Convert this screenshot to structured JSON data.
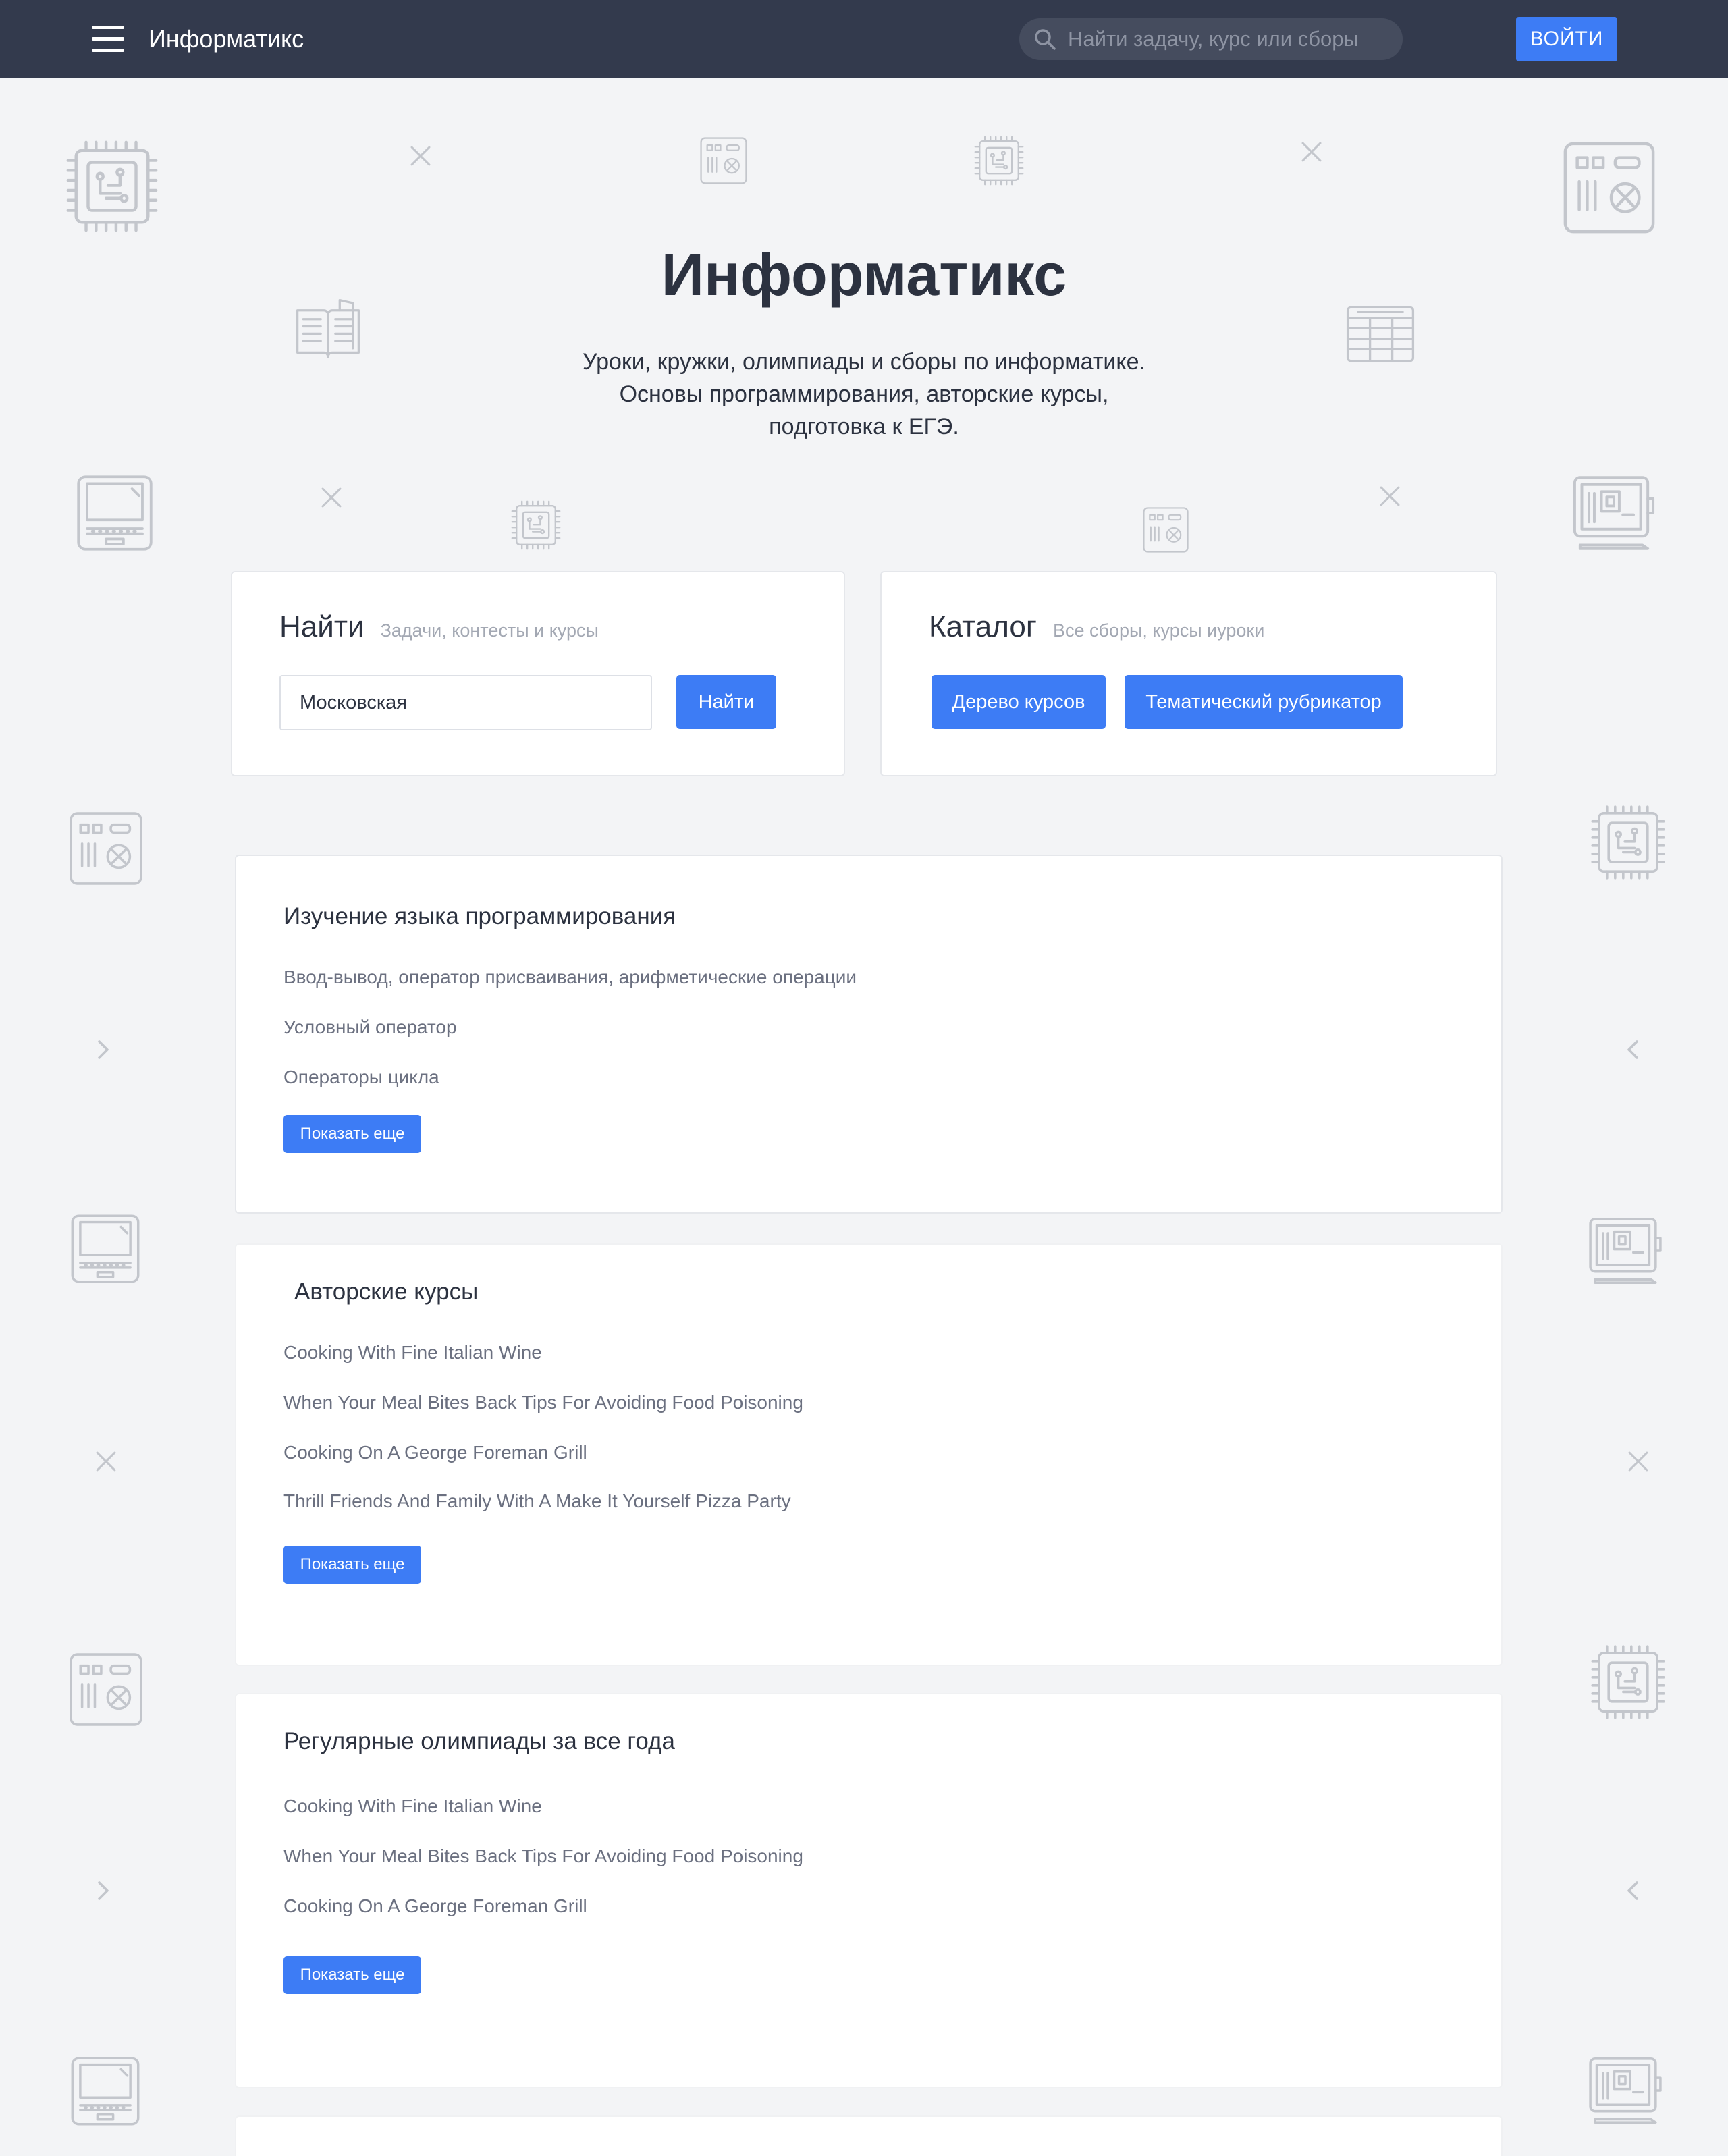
{
  "header": {
    "brand": "Информатикс",
    "search_placeholder": "Найти задачу, курс или сборы",
    "login_label": "ВОЙТИ"
  },
  "hero": {
    "title": "Информатикс",
    "subtitle_lines": [
      "Уроки, кружки, олимпиады и сборы по информатике.",
      "Основы программирования, авторские курсы,",
      "подготовка к ЕГЭ."
    ]
  },
  "find_card": {
    "title": "Найти",
    "hint": "Задачи, контесты и курсы",
    "input_value": "Московская",
    "button_label": "Найти"
  },
  "catalog_card": {
    "title": "Каталог",
    "hint": "Все сборы, курсы иуроки",
    "buttons": [
      "Дерево курсов",
      "Тематический рубрикатор"
    ]
  },
  "sections": [
    {
      "title": "Изучение языка программирования",
      "items": [
        "Ввод-вывод, оператор присваивания, арифметические операции",
        "Условный оператор",
        "Операторы цикла"
      ],
      "more_label": "Показать еще"
    },
    {
      "title": "Авторские курсы",
      "items": [
        "Cooking With Fine Italian Wine",
        "When Your Meal Bites Back Tips For Avoiding Food Poisoning",
        "Cooking On A George Foreman Grill",
        "Thrill Friends And Family With A Make It Yourself Pizza Party"
      ],
      "more_label": "Показать еще"
    },
    {
      "title": "Регулярные олимпиады за все года",
      "items": [
        "Cooking With Fine Italian Wine",
        "When Your Meal Bites Back Tips For Avoiding Food Poisoning",
        "Cooking On A George Foreman Grill"
      ],
      "more_label": "Показать еще"
    }
  ],
  "colors": {
    "header_bg": "#333a4d",
    "accent": "#3d7cf5",
    "page_bg": "#f3f4f6",
    "icon_gray": "#c3c6cc"
  }
}
